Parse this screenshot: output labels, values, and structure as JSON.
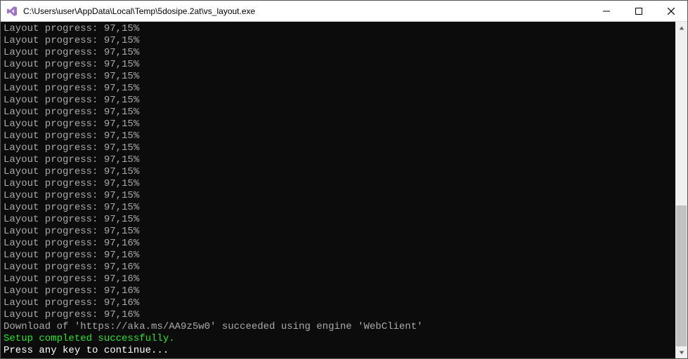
{
  "window": {
    "title": "C:\\Users\\user\\AppData\\Local\\Temp\\5dosipe.2at\\vs_layout.exe",
    "app_icon": "visual-studio"
  },
  "terminal": {
    "lines": [
      {
        "text": "Layout progress: 97,15%",
        "class": ""
      },
      {
        "text": "Layout progress: 97,15%",
        "class": ""
      },
      {
        "text": "Layout progress: 97,15%",
        "class": ""
      },
      {
        "text": "Layout progress: 97,15%",
        "class": ""
      },
      {
        "text": "Layout progress: 97,15%",
        "class": ""
      },
      {
        "text": "Layout progress: 97,15%",
        "class": ""
      },
      {
        "text": "Layout progress: 97,15%",
        "class": ""
      },
      {
        "text": "Layout progress: 97,15%",
        "class": ""
      },
      {
        "text": "Layout progress: 97,15%",
        "class": ""
      },
      {
        "text": "Layout progress: 97,15%",
        "class": ""
      },
      {
        "text": "Layout progress: 97,15%",
        "class": ""
      },
      {
        "text": "Layout progress: 97,15%",
        "class": ""
      },
      {
        "text": "Layout progress: 97,15%",
        "class": ""
      },
      {
        "text": "Layout progress: 97,15%",
        "class": ""
      },
      {
        "text": "Layout progress: 97,15%",
        "class": ""
      },
      {
        "text": "Layout progress: 97,15%",
        "class": ""
      },
      {
        "text": "Layout progress: 97,15%",
        "class": ""
      },
      {
        "text": "Layout progress: 97,15%",
        "class": ""
      },
      {
        "text": "Layout progress: 97,16%",
        "class": ""
      },
      {
        "text": "Layout progress: 97,16%",
        "class": ""
      },
      {
        "text": "Layout progress: 97,16%",
        "class": ""
      },
      {
        "text": "Layout progress: 97,16%",
        "class": ""
      },
      {
        "text": "Layout progress: 97,16%",
        "class": ""
      },
      {
        "text": "Layout progress: 97,16%",
        "class": ""
      },
      {
        "text": "Layout progress: 97,16%",
        "class": ""
      },
      {
        "text": "Download of 'https://aka.ms/AA9z5w0' succeeded using engine 'WebClient'",
        "class": ""
      },
      {
        "text": "Setup completed successfully.",
        "class": "success"
      },
      {
        "text": "Press any key to continue...",
        "class": "white"
      }
    ]
  }
}
